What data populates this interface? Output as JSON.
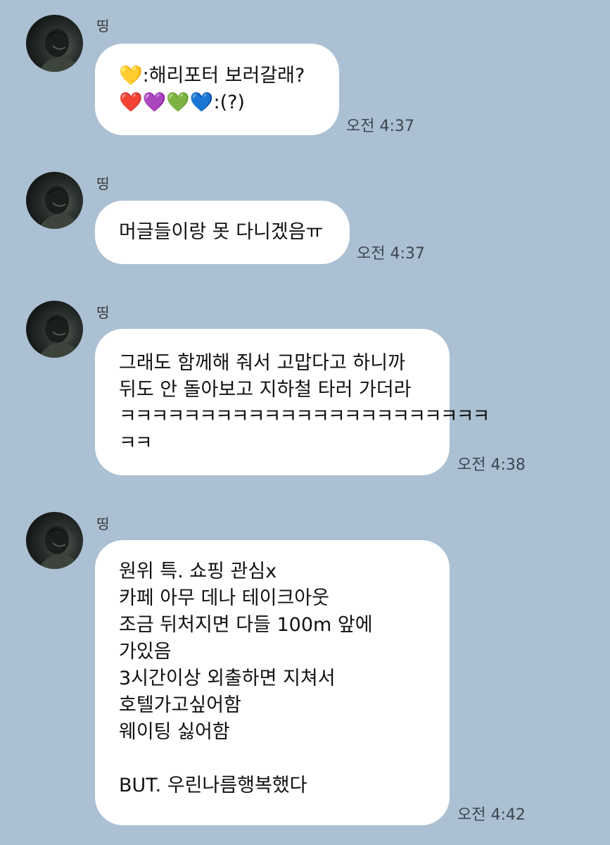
{
  "messages": [
    {
      "sender": "띵",
      "lines": [
        "💛:해리포터 보러갈래?",
        "❤️💜💚💙:(?)"
      ],
      "time": "오전 4:37"
    },
    {
      "sender": "띵",
      "lines": [
        "머글들이랑 못 다니겠음ㅠ"
      ],
      "time": "오전 4:37"
    },
    {
      "sender": "띵",
      "lines": [
        "그래도 함께해 줘서 고맙다고 하니까",
        "뒤도 안 돌아보고 지하철 타러 가더라",
        "ㅋㅋㅋㅋㅋㅋㅋㅋㅋㅋㅋㅋㅋㅋㅋㅋㅋㅋㅋㅋㅋㅋㅋ",
        "ㅋㅋ"
      ],
      "time": "오전 4:38"
    },
    {
      "sender": "띵",
      "lines": [
        "원위 특. 쇼핑 관심x",
        "카페 아무 데나 테이크아웃",
        "조금 뒤처지면 다들 100m 앞에",
        "가있음",
        "3시간이상 외출하면 지쳐서",
        "호텔가고싶어함",
        "웨이팅 싫어함",
        "",
        "BUT. 우린나름행복했다"
      ],
      "time": "오전 4:42"
    }
  ]
}
